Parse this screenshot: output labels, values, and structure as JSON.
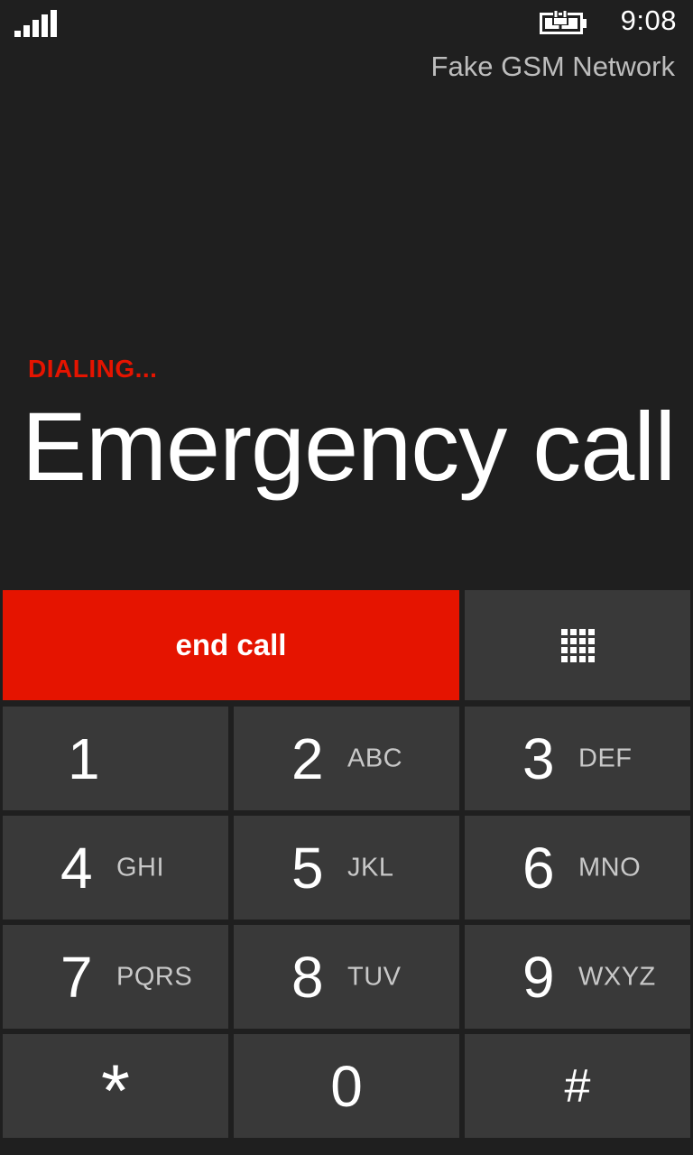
{
  "status_bar": {
    "signal_icon": "signal-strength-icon",
    "battery_icon": "battery-charging-icon",
    "time": "9:08"
  },
  "network_name": "Fake GSM Network",
  "call": {
    "status": "DIALING...",
    "callee": "Emergency call"
  },
  "actions": {
    "end_call_label": "end call",
    "keypad_icon": "keypad-grid-icon"
  },
  "keypad": {
    "keys": [
      {
        "digit": "1",
        "letters": ""
      },
      {
        "digit": "2",
        "letters": "ABC"
      },
      {
        "digit": "3",
        "letters": "DEF"
      },
      {
        "digit": "4",
        "letters": "GHI"
      },
      {
        "digit": "5",
        "letters": "JKL"
      },
      {
        "digit": "6",
        "letters": "MNO"
      },
      {
        "digit": "7",
        "letters": "PQRS"
      },
      {
        "digit": "8",
        "letters": "TUV"
      },
      {
        "digit": "9",
        "letters": "WXYZ"
      },
      {
        "digit": "*",
        "letters": ""
      },
      {
        "digit": "0",
        "letters": ""
      },
      {
        "digit": "#",
        "letters": ""
      }
    ]
  },
  "colors": {
    "background": "#1f1f1f",
    "accent_red": "#e51400",
    "key_background": "#393939",
    "secondary_text": "#bdbdbd"
  }
}
